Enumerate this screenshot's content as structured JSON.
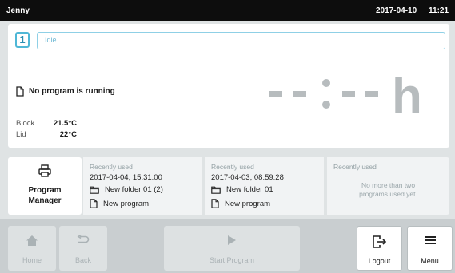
{
  "topbar": {
    "user": "Jenny",
    "date": "2017-04-10",
    "time": "11:21"
  },
  "status_panel": {
    "block_number": "1",
    "status": "Idle",
    "program_status": "No program is running",
    "timer_unit": "h",
    "block_label": "Block",
    "block_temp": "21.5°C",
    "lid_label": "Lid",
    "lid_temp": "22°C"
  },
  "program_manager": {
    "line1": "Program",
    "line2": "Manager",
    "icon": "printer-icon"
  },
  "recent": [
    {
      "title": "Recently used",
      "date": "2017-04-04, 15:31:00",
      "folder": "New folder 01 (2)",
      "program": "New program"
    },
    {
      "title": "Recently used",
      "date": "2017-04-03, 08:59:28",
      "folder": "New folder 01",
      "program": "New program"
    },
    {
      "title": "Recently used",
      "empty_line1": "No more than two",
      "empty_line2": "programs used yet."
    }
  ],
  "bottom_bar": {
    "home": "Home",
    "back": "Back",
    "start": "Start Program",
    "logout": "Logout",
    "menu": "Menu"
  },
  "colors": {
    "accent": "#4fb7d6",
    "timer_gray": "#b7bcbe",
    "topbar": "#0d0d0d"
  }
}
